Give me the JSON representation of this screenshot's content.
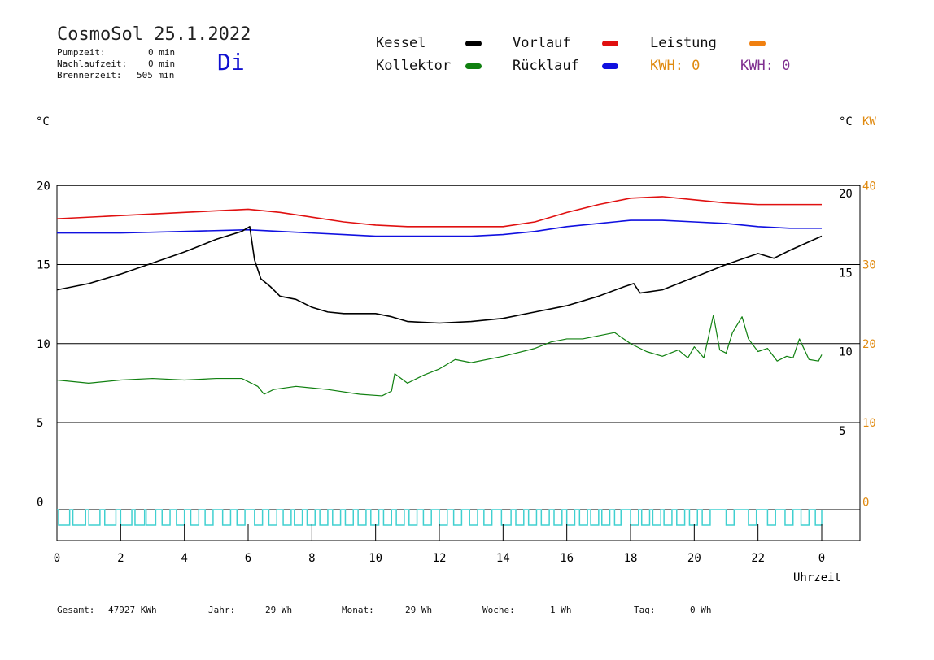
{
  "header": {
    "title": "CosmoSol 25.1.2022",
    "pumpzeit_label": "Pumpzeit:",
    "pumpzeit_value": "0 min",
    "nachlauf_label": "Nachlaufzeit:",
    "nachlauf_value": "0 min",
    "brenner_label": "Brennerzeit:",
    "brenner_value": "505 min",
    "weekday": "Di"
  },
  "legend": {
    "kessel": "Kessel",
    "kollektor": "Kollektor",
    "vorlauf": "Vorlauf",
    "ruecklauf": "Rücklauf",
    "leistung": "Leistung",
    "kwh1": "KWH: 0",
    "kwh2": "KWH: 0"
  },
  "colors": {
    "kessel": "#000000",
    "kollektor": "#108010",
    "vorlauf": "#e01010",
    "ruecklauf": "#1010e0",
    "leistung": "#f08010",
    "kwh2": "#803090",
    "pump": "#40d0d0",
    "kw_axis": "#e08a10"
  },
  "axes": {
    "left_unit": "°C",
    "right_unit": "°C",
    "right_unit2": "KW",
    "xlabel": "Uhrzeit"
  },
  "footer": {
    "gesamt_label": "Gesamt:",
    "gesamt_value": "47927 KWh",
    "jahr_label": "Jahr:",
    "jahr_value": "29 Wh",
    "monat_label": "Monat:",
    "monat_value": "29 Wh",
    "woche_label": "Woche:",
    "woche_value": "1 Wh",
    "tag_label": "Tag:",
    "tag_value": "0 Wh"
  },
  "chart_data": {
    "type": "line",
    "xlabel": "Uhrzeit",
    "xlim": [
      0,
      24
    ],
    "ylim": [
      -1,
      21
    ],
    "x_ticks": [
      0,
      2,
      4,
      6,
      8,
      10,
      12,
      14,
      16,
      18,
      20,
      22,
      24
    ],
    "x_tick_labels": [
      "0",
      "2",
      "4",
      "6",
      "8",
      "10",
      "12",
      "14",
      "16",
      "18",
      "20",
      "22",
      "0"
    ],
    "y_left_ticks": [
      0,
      5,
      10,
      15,
      20
    ],
    "y_right_ticks": [
      5,
      10,
      15,
      20
    ],
    "y_kw_ticks": [
      0,
      10,
      20,
      30,
      40
    ],
    "grid": true,
    "series": [
      {
        "name": "Vorlauf",
        "color": "#e01010",
        "x": [
          0,
          2,
          4,
          6,
          7,
          8,
          9,
          10,
          11,
          12,
          13,
          14,
          15,
          16,
          17,
          18,
          19,
          20,
          21,
          22,
          23,
          24
        ],
        "y": [
          18.4,
          18.6,
          18.8,
          19.0,
          18.8,
          18.5,
          18.2,
          18.0,
          17.9,
          17.9,
          17.9,
          17.9,
          18.2,
          18.8,
          19.3,
          19.7,
          19.8,
          19.6,
          19.4,
          19.3,
          19.3,
          19.3
        ]
      },
      {
        "name": "Rücklauf",
        "color": "#1010e0",
        "x": [
          0,
          2,
          4,
          6,
          7,
          8,
          9,
          10,
          11,
          12,
          13,
          14,
          15,
          16,
          17,
          18,
          19,
          20,
          21,
          22,
          23,
          24
        ],
        "y": [
          17.5,
          17.5,
          17.6,
          17.7,
          17.6,
          17.5,
          17.4,
          17.3,
          17.3,
          17.3,
          17.3,
          17.4,
          17.6,
          17.9,
          18.1,
          18.3,
          18.3,
          18.2,
          18.1,
          17.9,
          17.8,
          17.8
        ]
      },
      {
        "name": "Kessel",
        "color": "#000000",
        "x": [
          0,
          1,
          2,
          3,
          4,
          5,
          5.8,
          6.05,
          6.2,
          6.4,
          6.7,
          7,
          7.5,
          8,
          8.5,
          9,
          10,
          10.5,
          11,
          12,
          13,
          14,
          15,
          16,
          17,
          17.8,
          18.1,
          18.3,
          19,
          20,
          21,
          22,
          22.5,
          23,
          24
        ],
        "y": [
          13.9,
          14.3,
          14.9,
          15.6,
          16.3,
          17.1,
          17.6,
          17.9,
          15.8,
          14.6,
          14.1,
          13.5,
          13.3,
          12.8,
          12.5,
          12.4,
          12.4,
          12.2,
          11.9,
          11.8,
          11.9,
          12.1,
          12.5,
          12.9,
          13.5,
          14.1,
          14.3,
          13.7,
          13.9,
          14.7,
          15.5,
          16.2,
          15.9,
          16.4,
          17.3
        ]
      },
      {
        "name": "Kollektor",
        "color": "#108010",
        "x": [
          0,
          1,
          2,
          3,
          4,
          5,
          5.8,
          6.3,
          6.5,
          6.8,
          7.5,
          8.5,
          9.5,
          10.2,
          10.5,
          10.6,
          11,
          11.5,
          12,
          12.5,
          13,
          14,
          15,
          15.5,
          16,
          16.5,
          17,
          17.5,
          18,
          18.5,
          19,
          19.5,
          19.8,
          20,
          20.3,
          20.6,
          20.8,
          21,
          21.2,
          21.5,
          21.7,
          22,
          22.3,
          22.6,
          22.9,
          23.1,
          23.3,
          23.6,
          23.9,
          24
        ],
        "y": [
          8.2,
          8.0,
          8.2,
          8.3,
          8.2,
          8.3,
          8.3,
          7.8,
          7.3,
          7.6,
          7.8,
          7.6,
          7.3,
          7.2,
          7.5,
          8.6,
          8.0,
          8.5,
          8.9,
          9.5,
          9.3,
          9.7,
          10.2,
          10.6,
          10.8,
          10.8,
          11.0,
          11.2,
          10.5,
          10.0,
          9.7,
          10.1,
          9.6,
          10.3,
          9.6,
          12.3,
          10.1,
          9.9,
          11.2,
          12.2,
          10.8,
          10.0,
          10.2,
          9.4,
          9.7,
          9.6,
          10.8,
          9.5,
          9.4,
          9.8
        ]
      }
    ],
    "pump_segments": [
      [
        0.05,
        0.4
      ],
      [
        0.5,
        0.9
      ],
      [
        1.0,
        1.35
      ],
      [
        1.5,
        1.85
      ],
      [
        2.0,
        2.35
      ],
      [
        2.45,
        2.75
      ],
      [
        2.8,
        3.1
      ],
      [
        3.3,
        3.55
      ],
      [
        3.75,
        4.0
      ],
      [
        4.2,
        4.45
      ],
      [
        4.65,
        4.9
      ],
      [
        5.2,
        5.45
      ],
      [
        5.65,
        5.9
      ],
      [
        6.2,
        6.45
      ],
      [
        6.65,
        6.9
      ],
      [
        7.1,
        7.35
      ],
      [
        7.45,
        7.7
      ],
      [
        7.85,
        8.1
      ],
      [
        8.25,
        8.5
      ],
      [
        8.65,
        8.9
      ],
      [
        9.05,
        9.3
      ],
      [
        9.45,
        9.7
      ],
      [
        9.85,
        10.1
      ],
      [
        10.25,
        10.5
      ],
      [
        10.65,
        10.9
      ],
      [
        11.05,
        11.3
      ],
      [
        11.5,
        11.75
      ],
      [
        12.0,
        12.25
      ],
      [
        12.45,
        12.7
      ],
      [
        12.95,
        13.2
      ],
      [
        13.4,
        13.65
      ],
      [
        13.95,
        14.25
      ],
      [
        14.4,
        14.65
      ],
      [
        14.8,
        15.05
      ],
      [
        15.2,
        15.45
      ],
      [
        15.6,
        15.85
      ],
      [
        16.0,
        16.25
      ],
      [
        16.4,
        16.65
      ],
      [
        16.75,
        17.0
      ],
      [
        17.1,
        17.35
      ],
      [
        17.5,
        17.7
      ],
      [
        18.0,
        18.25
      ],
      [
        18.35,
        18.6
      ],
      [
        18.7,
        18.95
      ],
      [
        19.05,
        19.3
      ],
      [
        19.45,
        19.7
      ],
      [
        19.85,
        20.1
      ],
      [
        20.25,
        20.5
      ],
      [
        21.0,
        21.25
      ],
      [
        21.7,
        21.95
      ],
      [
        22.3,
        22.55
      ],
      [
        22.85,
        23.1
      ],
      [
        23.35,
        23.6
      ],
      [
        23.8,
        24.0
      ]
    ]
  }
}
